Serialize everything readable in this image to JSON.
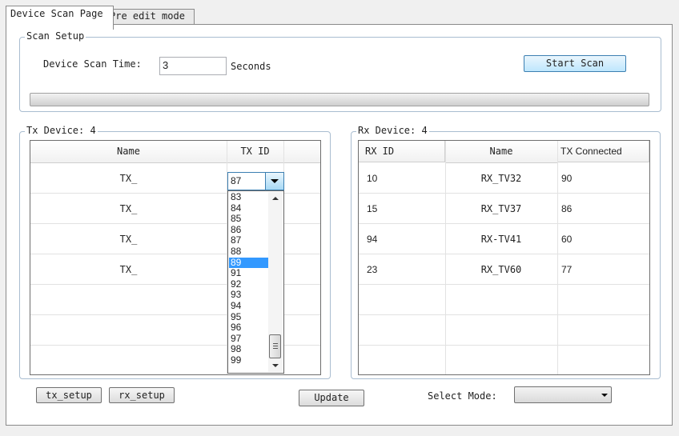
{
  "tabs": [
    {
      "label": "Device Scan Page",
      "active": true
    },
    {
      "label": "Pre edit mode",
      "active": false
    }
  ],
  "scan_setup": {
    "title": "Scan Setup",
    "time_label": "Device Scan Time:",
    "time_value": "3",
    "unit": "Seconds",
    "start_button": "Start Scan",
    "progress": 0
  },
  "tx": {
    "title": "Tx Device: 4",
    "columns": [
      "Name",
      "TX ID"
    ],
    "rows": [
      {
        "name": "TX_",
        "id": "87"
      },
      {
        "name": "TX_",
        "id": ""
      },
      {
        "name": "TX_",
        "id": ""
      },
      {
        "name": "TX_",
        "id": ""
      }
    ],
    "dropdown": {
      "selected": "87",
      "options": [
        "83",
        "84",
        "85",
        "86",
        "87",
        "88",
        "89",
        "91",
        "92",
        "93",
        "94",
        "95",
        "96",
        "97",
        "98",
        "99"
      ],
      "highlighted": "89"
    }
  },
  "rx": {
    "title": "Rx Device: 4",
    "columns": [
      "RX ID",
      "Name",
      "TX Connected"
    ],
    "rows": [
      {
        "id": "10",
        "name": "RX_TV32",
        "tx": "90"
      },
      {
        "id": "15",
        "name": "RX_TV37",
        "tx": "86"
      },
      {
        "id": "94",
        "name": "RX-TV41",
        "tx": "60"
      },
      {
        "id": "23",
        "name": "RX_TV60",
        "tx": "77"
      }
    ]
  },
  "bottom": {
    "tx_setup": "tx_setup",
    "rx_setup": "rx_setup",
    "update": "Update",
    "select_mode_label": "Select Mode:",
    "select_mode_value": ""
  },
  "colors": {
    "selection": "#3399ff",
    "group_border": "#a9bdd0"
  }
}
